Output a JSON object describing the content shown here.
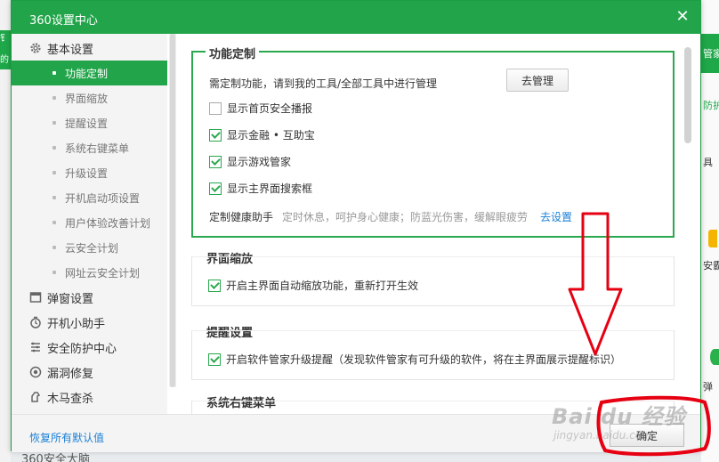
{
  "window": {
    "title": "360设置中心"
  },
  "background_app": {
    "bottom_text": "360安全大脑",
    "right_fragments": [
      "管家",
      "防护",
      "具",
      "安霸",
      "弹"
    ],
    "left_fragments": [
      "钅",
      "的"
    ]
  },
  "sidebar": {
    "groups": [
      {
        "label": "基本设置",
        "icon": "gear-icon"
      },
      {
        "label": "弹窗设置",
        "icon": "window-icon"
      },
      {
        "label": "开机小助手",
        "icon": "timer-icon"
      },
      {
        "label": "安全防护中心",
        "icon": "shield-list-icon"
      },
      {
        "label": "漏洞修复",
        "icon": "patch-icon"
      },
      {
        "label": "木马查杀",
        "icon": "horse-icon"
      }
    ],
    "subitems": [
      "功能定制",
      "界面缩放",
      "提醒设置",
      "系统右键菜单",
      "升级设置",
      "开机启动项设置",
      "用户体验改善计划",
      "云安全计划",
      "网址云安全计划"
    ],
    "active_subitem": "功能定制"
  },
  "sections": {
    "custom": {
      "title": "功能定制",
      "intro": "需定制功能，请到我的工具/全部工具中进行管理",
      "manage_button": "去管理",
      "options": [
        {
          "label": "显示首页安全播报",
          "checked": false
        },
        {
          "label": "显示金融 • 互助宝",
          "checked": true
        },
        {
          "label": "显示游戏管家",
          "checked": true
        },
        {
          "label": "显示主界面搜索框",
          "checked": true
        }
      ],
      "health": {
        "label": "定制健康助手",
        "desc": "定时休息，呵护身心健康；防蓝光伤害，缓解眼疲劳",
        "link": "去设置"
      }
    },
    "zoom": {
      "title": "界面缩放",
      "option": {
        "label": "开启主界面自动缩放功能，重新打开生效",
        "checked": true
      }
    },
    "reminder": {
      "title": "提醒设置",
      "option": {
        "label": "开启软件管家升级提醒（发现软件管家有可升级的软件，将在主界面展示提醒标识）",
        "checked": true
      }
    },
    "context_menu": {
      "title": "系统右键菜单"
    }
  },
  "footer": {
    "restore_link": "恢复所有默认值",
    "ok_button": "确定"
  },
  "watermark": {
    "line1": "Bai du 经验",
    "line2": "jingyan.baidu.com"
  },
  "colors": {
    "brand_green": "#22a54a",
    "annotation_red": "#e60012",
    "link_blue": "#1a7fd6"
  }
}
